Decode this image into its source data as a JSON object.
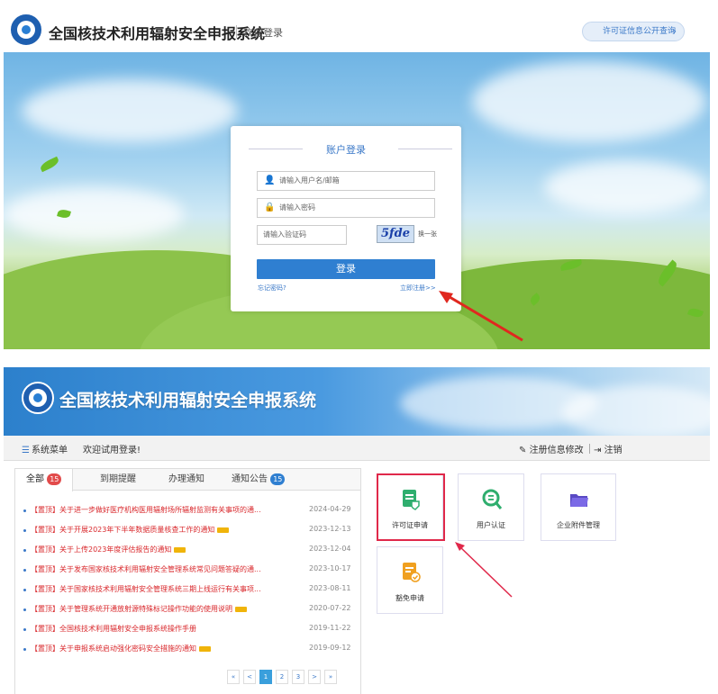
{
  "login_page": {
    "system_title": "全国核技术利用辐射安全申报系统",
    "welcome": "欢迎登录",
    "license_query_button": "许可证信息公开查询",
    "heading": "账户登录",
    "username_placeholder": "请输入用户名/邮箱",
    "password_placeholder": "请输入密码",
    "captcha_placeholder": "请输入验证码",
    "captcha_text": "5fde",
    "refresh_label": "换一张",
    "login_button": "登录",
    "forgot_password": "忘记密码?",
    "register_link": "立即注册>>"
  },
  "dashboard": {
    "system_title": "全国核技术利用辐射安全申报系统",
    "menu_toggle": "系统菜单",
    "welcome": "欢迎试用登录!",
    "edit_registration": "注册信息修改",
    "logout": "注销",
    "tabs": [
      {
        "label": "全部",
        "badge": "15"
      },
      {
        "label": "到期提醒"
      },
      {
        "label": "办理通知"
      },
      {
        "label": "通知公告",
        "badge": "15"
      }
    ],
    "notices": [
      {
        "title": "【置顶】关于进一步做好医疗机构医用辐射场所辐射监测有关事项的通...",
        "date": "2024-04-29",
        "new": false
      },
      {
        "title": "【置顶】关于开展2023年下半年数据质量核查工作的通知",
        "date": "2023-12-13",
        "new": true
      },
      {
        "title": "【置顶】关于上传2023年度评估报告的通知",
        "date": "2023-12-04",
        "new": true
      },
      {
        "title": "【置顶】关于发布国家核技术利用辐射安全管理系统常见问题答疑的通...",
        "date": "2023-10-17",
        "new": false
      },
      {
        "title": "【置顶】关于国家核技术利用辐射安全管理系统三期上线运行有关事项...",
        "date": "2023-08-11",
        "new": false
      },
      {
        "title": "【置顶】关于管理系统开通放射源特殊标记操作功能的使用说明",
        "date": "2020-07-22",
        "new": true
      },
      {
        "title": "【置顶】全国核技术利用辐射安全申报系统操作手册",
        "date": "2019-11-22",
        "new": false
      },
      {
        "title": "【置顶】关于申报系统启动强化密码安全措施的通知",
        "date": "2019-09-12",
        "new": true
      }
    ],
    "pager": [
      "«",
      "<",
      "1",
      "2",
      "3",
      ">",
      "»"
    ],
    "pager_current": "1",
    "functions": [
      {
        "label": "许可证申请",
        "icon": "license-doc-icon",
        "color": "#2fae6e"
      },
      {
        "label": "用户认证",
        "icon": "user-verify-icon",
        "color": "#2fae6e"
      },
      {
        "label": "企业附件管理",
        "icon": "folder-icon",
        "color": "#6b5bd6"
      },
      {
        "label": "豁免申请",
        "icon": "exemption-doc-icon",
        "color": "#f0a020"
      }
    ]
  },
  "colors": {
    "primary": "#2f7fd1",
    "highlight": "#e0284a",
    "notice_text": "#d9282c"
  }
}
